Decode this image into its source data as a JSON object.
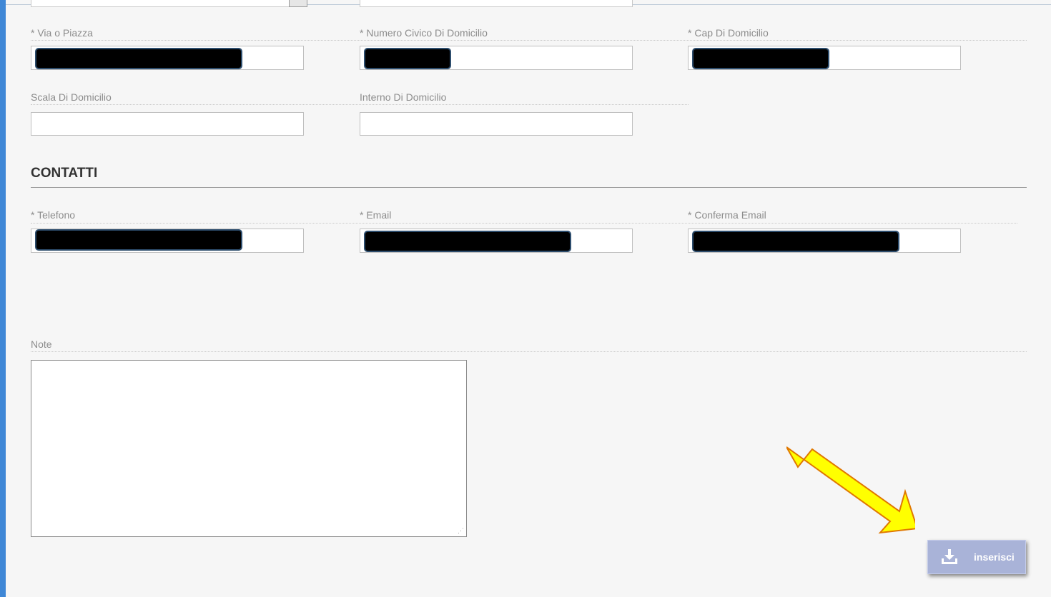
{
  "address": {
    "via_label": "* Via o Piazza",
    "numero_label": "* Numero Civico Di Domicilio",
    "cap_label": "* Cap Di Domicilio",
    "scala_label": "Scala Di Domicilio",
    "interno_label": "Interno Di Domicilio"
  },
  "contacts": {
    "section_title": "CONTATTI",
    "telefono_label": "* Telefono",
    "email_label": "* Email",
    "conferma_label": "* Conferma Email"
  },
  "notes": {
    "label": "Note"
  },
  "actions": {
    "submit_label": "inserisci",
    "submit_icon": "download-icon"
  },
  "colors": {
    "accent_bar": "#3f87d6",
    "arrow_fill": "#ffff00",
    "arrow_stroke": "#e07800",
    "button_bg": "#a9b3d8"
  }
}
